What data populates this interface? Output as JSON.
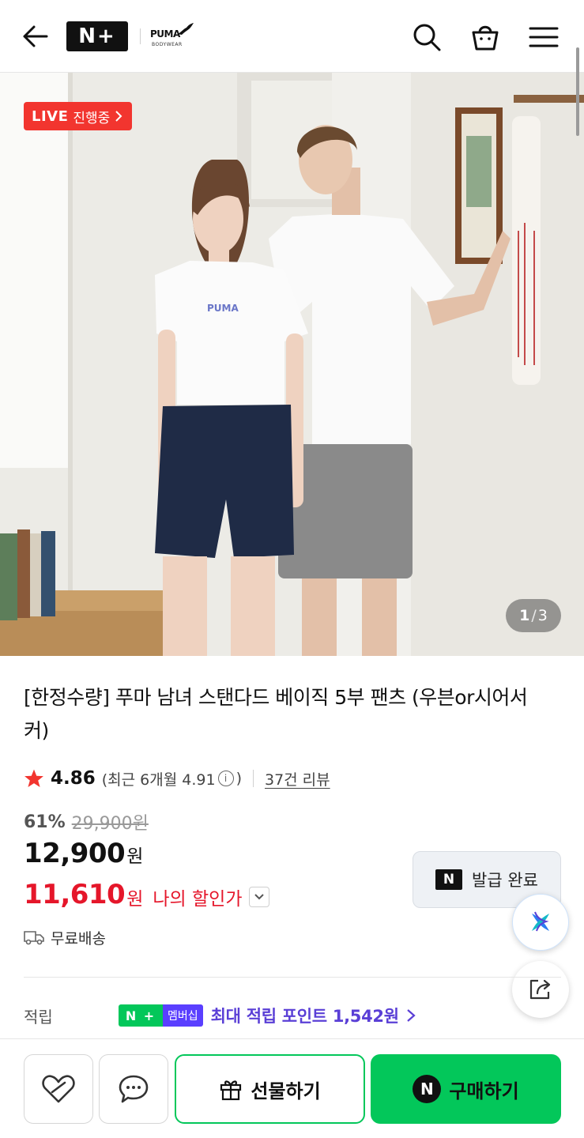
{
  "header": {
    "logo_text": "N+",
    "brand_name": "PUMA",
    "brand_sub": "BODYWEAR",
    "icons": [
      "back-arrow-icon",
      "search-icon",
      "shopping-bag-icon",
      "menu-icon"
    ]
  },
  "hero": {
    "live_word": "LIVE",
    "live_text": "진행중",
    "counter_current": "1",
    "counter_sep": "/",
    "counter_total": "3"
  },
  "product": {
    "title": "[한정수량] 푸마 남녀 스탠다드 베이직 5부 팬츠 (우븐or시어서커)",
    "rating": "4.86",
    "recent_label": "(최근 6개월 4.91",
    "recent_close": ")",
    "reviews": "37건 리뷰",
    "discount": "61%",
    "original_price": "29,900원",
    "price": "12,900",
    "price_unit": "원",
    "my_price": "11,610",
    "my_price_unit": "원",
    "my_price_label": "나의 할인가",
    "coupon_label": "발급 완료",
    "coupon_n": "N",
    "shipping": "무료배송"
  },
  "points": {
    "label": "적립",
    "badge_n": "N +",
    "badge_text": "멤버십",
    "text": "최대 적립 포인트 1,542원"
  },
  "bottom": {
    "gift_label": "선물하기",
    "buy_label": "구매하기",
    "buy_n": "N"
  },
  "colors": {
    "naver_green": "#03c75a",
    "live_red": "#f2352f",
    "sale_red": "#e5162a",
    "membership_purple": "#5a3fd6"
  }
}
